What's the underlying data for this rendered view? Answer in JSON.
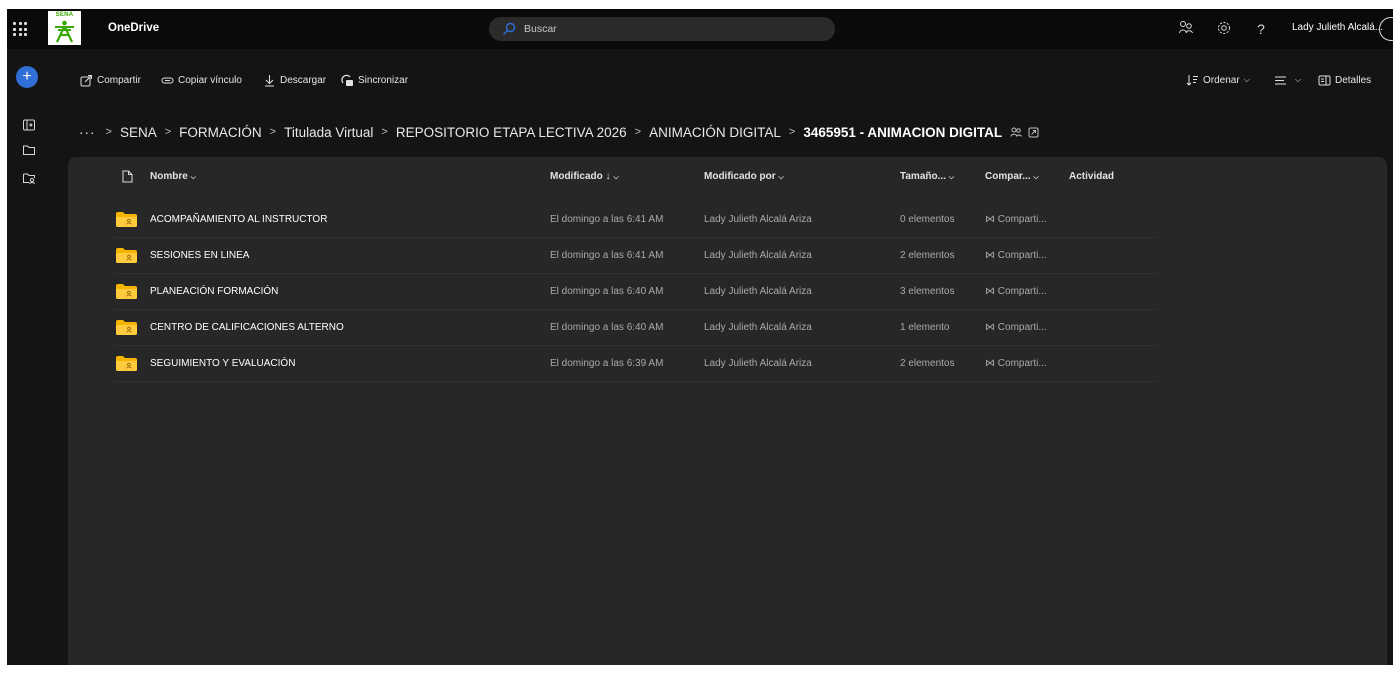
{
  "topbar": {
    "logo_text": "SENA",
    "app_title": "OneDrive",
    "search_placeholder": "Buscar",
    "user_name": "Lady Julieth Alcalá..."
  },
  "commands": {
    "share": "Compartir",
    "copy_link": "Copiar vínculo",
    "download": "Descargar",
    "sync": "Sincronizar",
    "sort": "Ordenar",
    "details": "Detalles"
  },
  "breadcrumb": {
    "more": "···",
    "items": [
      "SENA",
      "FORMACIÓN",
      "Titulada Virtual",
      "REPOSITORIO ETAPA LECTIVA 2026",
      "ANIMACIÓN DIGITAL"
    ],
    "current": "3465951 - ANIMACION DIGITAL"
  },
  "table": {
    "headers": {
      "name": "Nombre",
      "modified": "Modificado ↓",
      "modified_by": "Modificado por",
      "size": "Tamaño...",
      "sharing": "Compar...",
      "activity": "Actividad"
    },
    "rows": [
      {
        "name": "ACOMPAÑAMIENTO AL INSTRUCTOR",
        "modified": "El domingo a las 6:41 AM",
        "modified_by": "Lady Julieth Alcalá Ariza",
        "size": "0 elementos",
        "sharing": "Comparti..."
      },
      {
        "name": "SESIONES EN LINEA",
        "modified": "El domingo a las 6:41 AM",
        "modified_by": "Lady Julieth Alcalá Ariza",
        "size": "2 elementos",
        "sharing": "Comparti..."
      },
      {
        "name": "PLANEACIÓN FORMACIÓN",
        "modified": "El domingo a las 6:40 AM",
        "modified_by": "Lady Julieth Alcalá Ariza",
        "size": "3 elementos",
        "sharing": "Comparti..."
      },
      {
        "name": "CENTRO DE CALIFICACIONES ALTERNO",
        "modified": "El domingo a las 6:40 AM",
        "modified_by": "Lady Julieth Alcalá Ariza",
        "size": "1 elemento",
        "sharing": "Comparti..."
      },
      {
        "name": "SEGUIMIENTO Y EVALUACIÓN",
        "modified": "El domingo a las 6:39 AM",
        "modified_by": "Lady Julieth Alcalá Ariza",
        "size": "2 elementos",
        "sharing": "Comparti..."
      }
    ]
  },
  "colors": {
    "background": "#141414",
    "topbar": "#0a0a0a",
    "card": "#272727",
    "accent": "#2f6fd6",
    "folder": "#f4b400",
    "brand_green": "#39a900"
  }
}
